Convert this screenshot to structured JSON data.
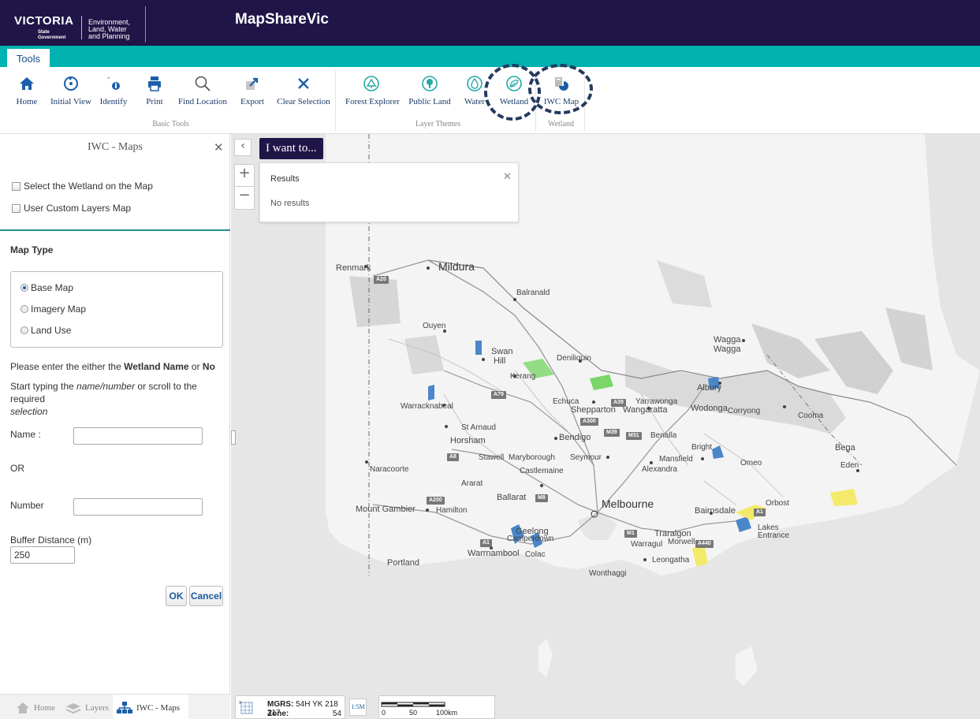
{
  "header": {
    "logo_word": "VICTORIA",
    "logo_sub_line1": "State",
    "logo_sub_line2": "Government",
    "dept_line1": "Environment,",
    "dept_line2": "Land, Water",
    "dept_line3": "and Planning",
    "app_title": "MapShareVic"
  },
  "tabs": {
    "tools": "Tools"
  },
  "ribbon": {
    "basic_tools": {
      "label": "Basic Tools",
      "items": [
        "Home",
        "Initial View",
        "Identify",
        "Print",
        "Find Location",
        "Export",
        "Clear Selection"
      ]
    },
    "layer_themes": {
      "label": "Layer Themes",
      "items": [
        "Forest Explorer",
        "Public Land",
        "Water",
        "Wetland"
      ]
    },
    "wetland": {
      "label": "Wetland",
      "items": [
        "IWC Map"
      ]
    }
  },
  "panel": {
    "title": "IWC - Maps",
    "checkbox_select_wetland": "Select the Wetland on the Map",
    "checkbox_custom_layers": "User Custom Layers Map",
    "map_type_title": "Map Type",
    "map_types": [
      "Base Map",
      "Imagery Map",
      "Land Use"
    ],
    "selected_map_type": "Base Map",
    "instruction_prefix": "Please enter the either the ",
    "instruction_bold1": "Wetland Name",
    "instruction_mid": " or ",
    "instruction_bold2": "No",
    "hint_prefix": "Start typing the ",
    "hint_italic": "name/number",
    "hint_suffix": " or scroll to the required",
    "hint_italic2": "selection",
    "name_label": "Name :",
    "name_value": "",
    "or_label": "OR",
    "number_label": "Number",
    "number_value": "",
    "buffer_label": "Buffer Distance (m)",
    "buffer_value": "250",
    "ok_label": "OK",
    "cancel_label": "Cancel"
  },
  "bottom_tabs": [
    "Home",
    "Layers",
    "IWC - Maps"
  ],
  "map": {
    "i_want_to": "I want to...",
    "results_title": "Results",
    "no_results": "No results",
    "mgrs_label": "MGRS:",
    "mgrs_value": "54H YK 218 317",
    "zone_label": "Zone:",
    "zone_value": "54",
    "scale_toggle": "1:5M",
    "scale_labels": [
      "0",
      "50",
      "100km"
    ],
    "places": {
      "renmark": "Renmark",
      "mildura": "Mildura",
      "balranald": "Balranald",
      "ouyen": "Ouyen",
      "swan_hill": "Swan",
      "swan_hill2": "Hill",
      "deniliquin": "Deniliquin",
      "kerang": "Kerang",
      "wagga": "Wagga",
      "wagga2": "Wagga",
      "albury": "Albury",
      "echuca": "Echuca",
      "yarrawonga": "Yarrawonga",
      "warracknabeal": "Warracknabeal",
      "shepparton": "Shepparton",
      "wangaratta": "Wangaratta",
      "wodonga": "Wodonga",
      "corryong": "Corryong",
      "cooma": "Cooma",
      "st_arnaud": "St Arnaud",
      "benalla": "Benalla",
      "horsham": "Horsham",
      "bendigo": "Bendigo",
      "bright": "Bright",
      "bega": "Bega",
      "stawell": "Stawell",
      "maryborough": "Maryborough",
      "seymour": "Seymour",
      "mansfield": "Mansfield",
      "omeo": "Omeo",
      "eden": "Eden",
      "naracoorte": "Naracoorte",
      "castlemaine": "Castlemaine",
      "alexandra": "Alexandra",
      "ararat": "Ararat",
      "ballarat": "Ballarat",
      "melbourne": "Melbourne",
      "orbost": "Orbost",
      "mount_gambier": "Mount Gambier",
      "hamilton": "Hamilton",
      "bairnsdale": "Bairnsdale",
      "lakes_entrance": "Lakes",
      "lakes_entrance2": "Entrance",
      "geelong": "Geelong",
      "camperdown": "Camperdown",
      "traralgon": "Traralgon",
      "morwell": "Morwell",
      "warragul": "Warragul",
      "warrnambool": "Warrnambool",
      "colac": "Colac",
      "leongatha": "Leongatha",
      "portland": "Portland",
      "wonthaggi": "Wonthaggi"
    },
    "shields": [
      "A20",
      "A79",
      "A39",
      "A300",
      "M39",
      "M31",
      "A8",
      "A200",
      "M8",
      "A1",
      "M1",
      "A440",
      "A1"
    ]
  },
  "colors": {
    "header_bg": "#201547",
    "teal": "#00b2b0",
    "wetland_blue": "#4a86c8",
    "accent_green": "#7ad66a",
    "accent_yellow": "#f3ea6a"
  }
}
